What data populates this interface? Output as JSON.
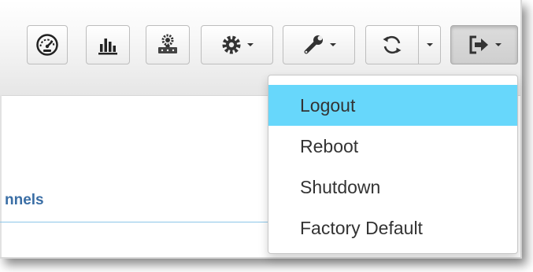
{
  "toolbar": {
    "buttons": [
      {
        "icon": "dashboard-gauge-icon"
      },
      {
        "icon": "bar-chart-icon"
      },
      {
        "icon": "server-settings-icon"
      },
      {
        "icon": "gear-icon",
        "dropdown": true
      },
      {
        "icon": "wrench-icon",
        "dropdown": true
      },
      {
        "icon": "refresh-icon",
        "dropdown": true
      },
      {
        "icon": "sign-out-icon",
        "dropdown": true,
        "active": true
      }
    ]
  },
  "content": {
    "tab_label": "nnels"
  },
  "logout_menu": {
    "items": [
      {
        "label": "Logout",
        "highlighted": true
      },
      {
        "label": "Reboot"
      },
      {
        "label": "Shutdown"
      },
      {
        "label": "Factory Default"
      }
    ]
  },
  "colors": {
    "highlight": "#67d7fb",
    "tab_text": "#3a6ea5",
    "tab_underline": "#8cc6e8"
  }
}
